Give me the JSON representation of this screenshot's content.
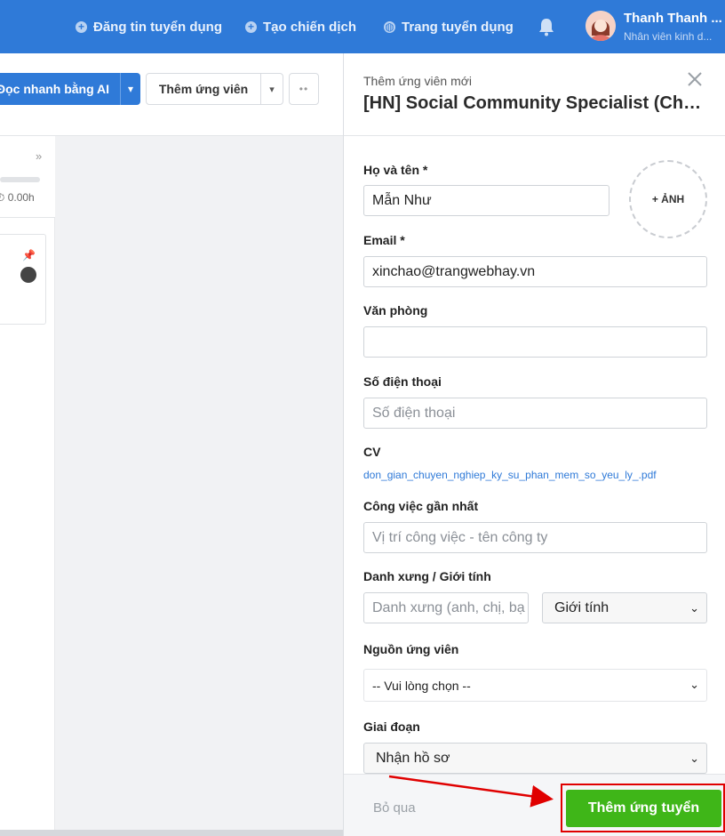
{
  "topbar": {
    "nav": [
      {
        "label": "Đăng tin tuyển dụng"
      },
      {
        "label": "Tạo chiến dịch"
      },
      {
        "label": "Trang tuyển dụng"
      }
    ],
    "user": {
      "name": "Thanh Thanh ...",
      "role": "Nhân viên kinh d..."
    }
  },
  "toolbar": {
    "ai_label": "Đọc nhanh bằng AI",
    "add_label": "Thêm ứng viên",
    "more_label": "••"
  },
  "column": {
    "time": "⏱ 0.00h"
  },
  "drawer": {
    "subtitle": "Thêm ứng viên mới",
    "title": "[HN] Social Community Specialist (Chuyên viên)",
    "photo_label": "+ ẢNH",
    "fields": {
      "name": {
        "label": "Họ và tên *",
        "value": "Mẫn Như"
      },
      "email": {
        "label": "Email *",
        "value": "xinchao@trangwebhay.vn"
      },
      "office": {
        "label": "Văn phòng",
        "value": ""
      },
      "phone": {
        "label": "Số điện thoại",
        "placeholder": "Số điện thoại"
      },
      "cv": {
        "label": "CV",
        "file": "don_gian_chuyen_nghiep_ky_su_phan_mem_so_yeu_ly_.pdf"
      },
      "recent_job": {
        "label": "Công việc gần nhất",
        "placeholder": "Vị trí công việc - tên công ty"
      },
      "title_gender": {
        "label": "Danh xưng / Giới tính",
        "title_placeholder": "Danh xưng (anh, chị, bạ",
        "gender_value": "Giới tính"
      },
      "source": {
        "label": "Nguồn ứng viên",
        "value": "-- Vui lòng chọn --"
      },
      "stage": {
        "label": "Giai đoạn",
        "value": "Nhận hồ sơ"
      }
    },
    "footer": {
      "skip_label": "Bỏ qua",
      "submit_label": "Thêm ứng tuyển"
    }
  },
  "colors": {
    "brand": "#2f7ad8",
    "submit": "#3fb618",
    "highlight": "#e00000"
  }
}
